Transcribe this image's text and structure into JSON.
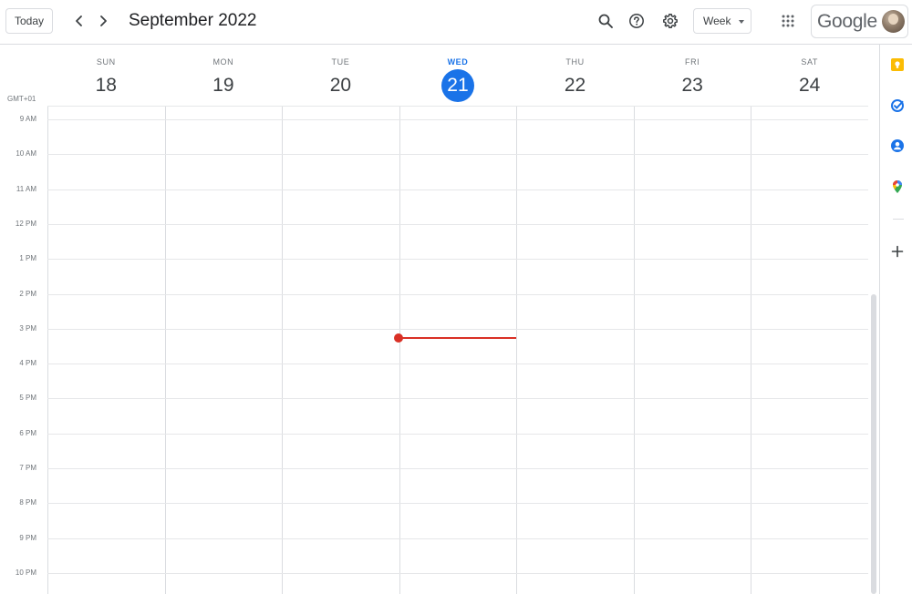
{
  "header": {
    "today_label": "Today",
    "title": "September 2022",
    "view_label": "Week",
    "brand": "Google"
  },
  "timezone": "GMT+01",
  "days": [
    {
      "name": "SUN",
      "num": "18"
    },
    {
      "name": "MON",
      "num": "19"
    },
    {
      "name": "TUE",
      "num": "20"
    },
    {
      "name": "WED",
      "num": "21",
      "today": true
    },
    {
      "name": "THU",
      "num": "22"
    },
    {
      "name": "FRI",
      "num": "23"
    },
    {
      "name": "SAT",
      "num": "24"
    }
  ],
  "time_labels": [
    "9 AM",
    "10 AM",
    "11 AM",
    "12 PM",
    "1 PM",
    "2 PM",
    "3 PM",
    "4 PM",
    "5 PM",
    "6 PM",
    "7 PM",
    "8 PM",
    "9 PM",
    "10 PM"
  ],
  "colors": {
    "accent": "#1a73e8",
    "now_indicator": "#d93025",
    "keep": "#fbbc04",
    "tasks": "#1a73e8",
    "contacts": "#1a73e8"
  },
  "side_icons": [
    "keep-icon",
    "tasks-icon",
    "contacts-icon",
    "maps-icon",
    "add-icon"
  ]
}
